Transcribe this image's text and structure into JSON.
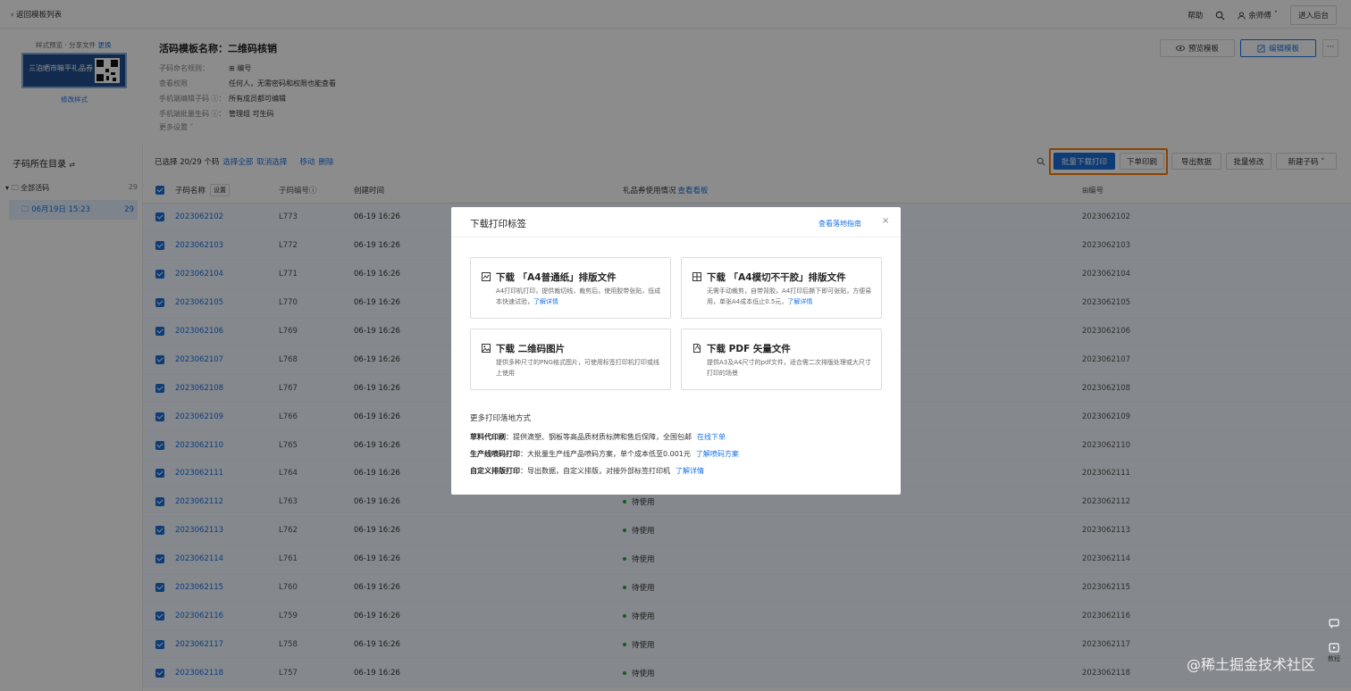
{
  "topbar": {
    "back_label": "返回模板列表",
    "help": "帮助",
    "user": "余师傅",
    "enter_admin": "进入后台"
  },
  "header": {
    "style_links": {
      "preview": "样式预览",
      "share": "分享文件",
      "switch": "更换"
    },
    "thumb_text": "三泊晒市嘛平礼品券",
    "modify_style": "修改样式",
    "title": "活码模板名称：二维码核销",
    "meta": [
      {
        "key": "子码命名规则：",
        "value": "⊞ 编号"
      },
      {
        "key": "查看权限",
        "value": "任何人，无需密码和权限也能查看"
      },
      {
        "key": "手机端编辑子码 ⓘ：",
        "value": "所有成员都可编辑"
      },
      {
        "key": "手机端批量生码 ⓘ：",
        "value": "管理组 可生码"
      }
    ],
    "more_settings": "更多设置 ˅",
    "preview_btn": "预览模板",
    "edit_btn": "编辑模板",
    "more_btn": "···"
  },
  "sidebar": {
    "title": "子码所在目录",
    "all_label": "全部活码",
    "all_count": "29",
    "selected_label": "06月19日 15:23",
    "selected_count": "29"
  },
  "toolbar": {
    "selected_info": "已选择 20/29 个码",
    "select_all": "选择全部",
    "cancel_select": "取消选择",
    "move": "移动",
    "delete": "删除",
    "batch_print": "批量下载打印",
    "order_print": "下单印刷",
    "export": "导出数据",
    "batch_edit": "批量修改",
    "new_code": "新建子码 ˅"
  },
  "table": {
    "headers": {
      "name": "子码名称",
      "settings": "设置",
      "code": "子码编号ⓘ",
      "created": "创建时间",
      "usage": "礼品券使用情况",
      "view_board": "查看看板",
      "number": "⊞编号"
    },
    "rows": [
      {
        "name": "2023062102",
        "code": "L773",
        "time": "06-19 16:26",
        "status": "",
        "num": "2023062102"
      },
      {
        "name": "2023062103",
        "code": "L772",
        "time": "06-19 16:26",
        "status": "",
        "num": "2023062103"
      },
      {
        "name": "2023062104",
        "code": "L771",
        "time": "06-19 16:26",
        "status": "",
        "num": "2023062104"
      },
      {
        "name": "2023062105",
        "code": "L770",
        "time": "06-19 16:26",
        "status": "",
        "num": "2023062105"
      },
      {
        "name": "2023062106",
        "code": "L769",
        "time": "06-19 16:26",
        "status": "",
        "num": "2023062106"
      },
      {
        "name": "2023062107",
        "code": "L768",
        "time": "06-19 16:26",
        "status": "",
        "num": "2023062107"
      },
      {
        "name": "2023062108",
        "code": "L767",
        "time": "06-19 16:26",
        "status": "",
        "num": "2023062108"
      },
      {
        "name": "2023062109",
        "code": "L766",
        "time": "06-19 16:26",
        "status": "",
        "num": "2023062109"
      },
      {
        "name": "2023062110",
        "code": "L765",
        "time": "06-19 16:26",
        "status": "",
        "num": "2023062110"
      },
      {
        "name": "2023062111",
        "code": "L764",
        "time": "06-19 16:26",
        "status": "",
        "num": "2023062111"
      },
      {
        "name": "2023062112",
        "code": "L763",
        "time": "06-19 16:26",
        "status": "待使用",
        "num": "2023062112"
      },
      {
        "name": "2023062113",
        "code": "L762",
        "time": "06-19 16:26",
        "status": "待使用",
        "num": "2023062113"
      },
      {
        "name": "2023062114",
        "code": "L761",
        "time": "06-19 16:26",
        "status": "待使用",
        "num": "2023062114"
      },
      {
        "name": "2023062115",
        "code": "L760",
        "time": "06-19 16:26",
        "status": "待使用",
        "num": "2023062115"
      },
      {
        "name": "2023062116",
        "code": "L759",
        "time": "06-19 16:26",
        "status": "待使用",
        "num": "2023062116"
      },
      {
        "name": "2023062117",
        "code": "L758",
        "time": "06-19 16:26",
        "status": "待使用",
        "num": "2023062117"
      },
      {
        "name": "2023062118",
        "code": "L757",
        "time": "06-19 16:26",
        "status": "待使用",
        "num": "2023062118"
      }
    ]
  },
  "modal": {
    "title": "下载打印标签",
    "guide": "查看落地指南",
    "close": "×",
    "options": [
      {
        "title": "下载 「A4普通纸」排版文件",
        "desc": "A4打印机打印，提供裁切线，裁剪后，使用胶带张贴，低成本快速试验，",
        "link": "了解详情",
        "icon": "image-grid-icon"
      },
      {
        "title": "下载 「A4模切不干胶」排版文件",
        "desc": "无需手动裁剪，自带背胶，A4打印后撕下即可张贴，方便易用，单张A4成本低止0.5元，",
        "link": "了解详情",
        "icon": "grid-icon"
      },
      {
        "title": "下载 二维码图片",
        "desc": "提供多种尺寸的PNG格式图片，可使用标签打印机打印或线上使用",
        "link": "",
        "icon": "picture-icon"
      },
      {
        "title": "下载 PDF 矢量文件",
        "desc": "提供A3及A4尺寸的pdf文件，适合需二次排版处理或大尺寸打印的场景",
        "link": "",
        "icon": "pdf-icon"
      }
    ],
    "more_ways_title": "更多打印落地方式",
    "ways": [
      {
        "name": "草料代印刷",
        "desc": "：提供滴塑、钢板等高品质材质标牌和售后保障，全国包邮",
        "link": "在线下单"
      },
      {
        "name": "生产线喷码打印",
        "desc": "：大批量生产线产品喷码方案，单个成本低至0.001元",
        "link": "了解喷码方案"
      },
      {
        "name": "自定义排版打印",
        "desc": "：导出数据，自定义排版，对接外部标签打印机",
        "link": "了解详情"
      }
    ]
  },
  "float": {
    "tutorial": "教程"
  },
  "watermark": "@稀土掘金技术社区",
  "colors": {
    "accent": "#1a6ed8",
    "highlight": "#ff7a00",
    "status": "#2aa845"
  }
}
